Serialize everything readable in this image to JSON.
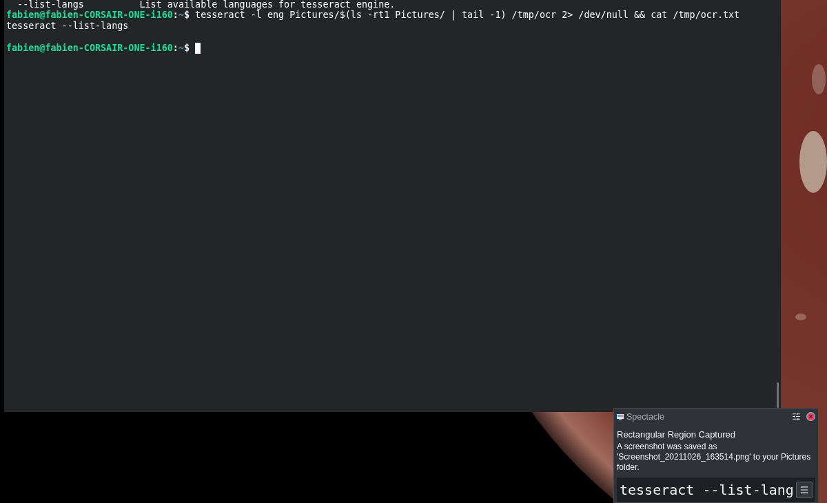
{
  "terminal": {
    "lines": [
      {
        "kind": "help_row",
        "option": "--list-langs",
        "description": "List available languages for tesseract engine."
      },
      {
        "kind": "prompt",
        "user_host": "fabien@fabien-CORSAIR-ONE-i160",
        "separator": ":",
        "path": "~",
        "symbol": "$",
        "command": "tesseract -l eng Pictures/$(ls -rt1 Pictures/ | tail -1) /tmp/ocr 2> /dev/null && cat /tmp/ocr.txt",
        "cursor": false
      },
      {
        "kind": "output",
        "text": "tesseract --list-langs"
      },
      {
        "kind": "blank"
      },
      {
        "kind": "prompt",
        "user_host": "fabien@fabien-CORSAIR-ONE-i160",
        "separator": ":",
        "path": "~",
        "symbol": "$",
        "cursor": true
      }
    ]
  },
  "notification": {
    "app": "Spectacle",
    "title": "Rectangular Region Captured",
    "body": "A screenshot was saved as 'Screenshot_20211026_163514.png' to your Pictures folder.",
    "preview_text": "tesseract --list-lang"
  }
}
